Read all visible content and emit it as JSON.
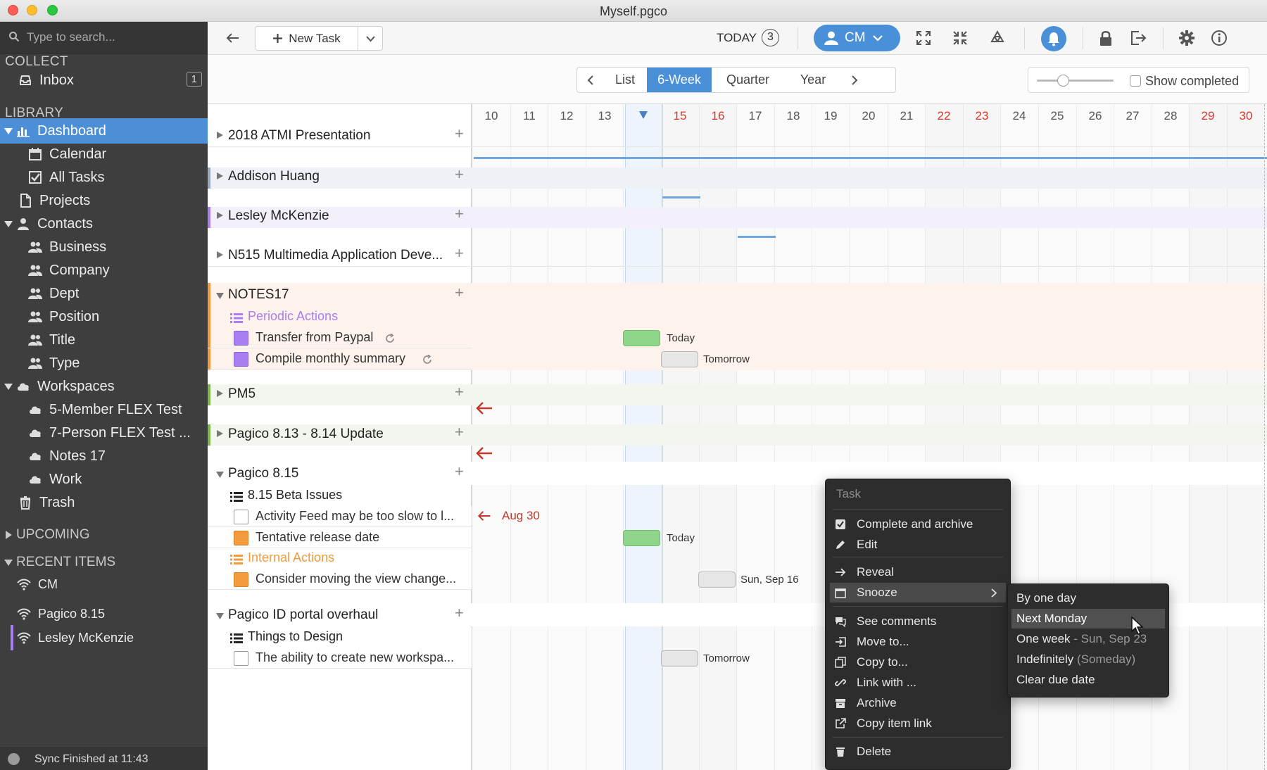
{
  "window": {
    "title": "Myself.pgco"
  },
  "sidebar": {
    "search_placeholder": "Type to search...",
    "collect_label": "COLLECT",
    "inbox": {
      "label": "Inbox",
      "count": "1"
    },
    "library_label": "LIBRARY",
    "items": [
      {
        "label": "Dashboard"
      },
      {
        "label": "Calendar"
      },
      {
        "label": "All Tasks"
      },
      {
        "label": "Projects"
      },
      {
        "label": "Contacts"
      },
      {
        "label": "Business"
      },
      {
        "label": "Company"
      },
      {
        "label": "Dept"
      },
      {
        "label": "Position"
      },
      {
        "label": "Title"
      },
      {
        "label": "Type"
      },
      {
        "label": "Workspaces"
      },
      {
        "label": "5-Member FLEX Test"
      },
      {
        "label": "7-Person FLEX Test ..."
      },
      {
        "label": "Notes 17"
      },
      {
        "label": "Work"
      },
      {
        "label": "Trash"
      }
    ],
    "upcoming_label": "UPCOMING",
    "recent_label": "RECENT ITEMS",
    "recent": [
      {
        "label": "CM"
      },
      {
        "label": "Pagico 8.15"
      },
      {
        "label": "Lesley McKenzie"
      }
    ],
    "status": "Sync Finished at 11:43"
  },
  "toolbar": {
    "new_task": "New Task",
    "today_label": "TODAY",
    "today_count": "3",
    "user_initials": "CM"
  },
  "viewbar": {
    "tabs": [
      "List",
      "6-Week",
      "Quarter",
      "Year"
    ],
    "active_tab": "6-Week",
    "show_completed": "Show completed"
  },
  "timeline": {
    "days": [
      "10",
      "11",
      "12",
      "13",
      "14",
      "15",
      "16",
      "17",
      "18",
      "19",
      "20",
      "21",
      "22",
      "23",
      "24",
      "25",
      "26",
      "27",
      "28",
      "29",
      "30"
    ],
    "today_marker_day": "14",
    "weekend_days": [
      "15",
      "16",
      "22",
      "23",
      "29",
      "30"
    ]
  },
  "rows": {
    "atmi": "2018 ATMI Presentation",
    "addison": "Addison Huang",
    "lesley": "Lesley McKenzie",
    "n515": "N515 Multimedia Application Deve...",
    "notes17": "NOTES17",
    "periodic": "Periodic Actions",
    "paypal": "Transfer from Paypal",
    "paypal_due": "Today",
    "monthly": "Compile monthly summary",
    "monthly_due": "Tomorrow",
    "pm5": "PM5",
    "p813": "Pagico 8.13 - 8.14 Update",
    "p815": "Pagico 8.15",
    "beta": "8.15 Beta Issues",
    "activity": "Activity Feed may be too slow to l...",
    "activity_due": "Aug 30",
    "tentative": "Tentative release date",
    "tentative_due": "Today",
    "internal": "Internal Actions",
    "consider": "Consider moving the view change...",
    "consider_due": "Sun, Sep 16",
    "portal": "Pagico ID portal overhaul",
    "design": "Things to Design",
    "ability": "The ability to create new workspa...",
    "ability_due": "Tomorrow"
  },
  "context_menu": {
    "header": "Task",
    "complete": "Complete and archive",
    "edit": "Edit",
    "reveal": "Reveal",
    "snooze": "Snooze",
    "comments": "See comments",
    "move": "Move to...",
    "copy": "Copy to...",
    "link": "Link with ...",
    "archive": "Archive",
    "copy_link": "Copy item link",
    "delete": "Delete"
  },
  "snooze_menu": {
    "by_one_day": "By one day",
    "next_monday": "Next Monday",
    "one_week": "One week",
    "one_week_extra": " - Sun, Sep 23",
    "indefinitely": "Indefinitely",
    "indefinitely_extra": " (Someday)",
    "clear": "Clear due date"
  },
  "colors": {
    "accent": "#4a90d9",
    "today_pill": "#8fd68a",
    "weekend_red": "#d7362a",
    "purple": "#a97ef0",
    "orange": "#f39a3c"
  }
}
